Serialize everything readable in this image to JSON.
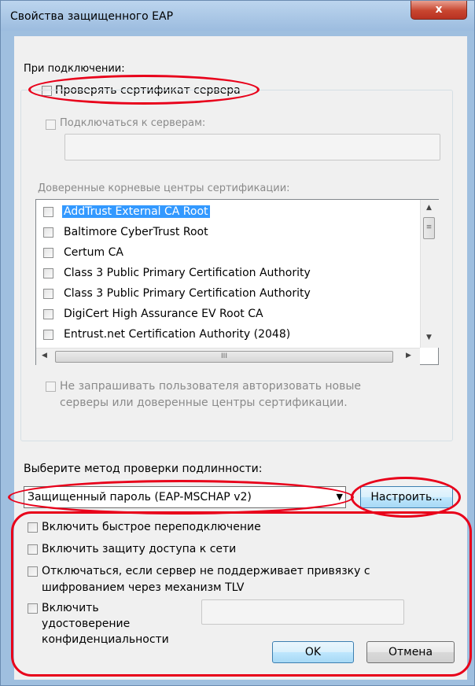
{
  "window": {
    "title": "Свойства защищенного EAP",
    "close_glyph": "x"
  },
  "connection": {
    "heading": "При подключении:",
    "verify_cert_label": "Проверять сертификат сервера",
    "connect_servers_label": "Подключаться к серверам:",
    "servers_value": "",
    "trusted_ca_label": "Доверенные корневые центры сертификации:",
    "ca_list": [
      {
        "label": "AddTrust External CA Root",
        "checked": false,
        "selected": true
      },
      {
        "label": "Baltimore CyberTrust Root",
        "checked": false,
        "selected": false
      },
      {
        "label": "Certum CA",
        "checked": false,
        "selected": false
      },
      {
        "label": "Class 3 Public Primary Certification Authority",
        "checked": false,
        "selected": false
      },
      {
        "label": "Class 3 Public Primary Certification Authority",
        "checked": false,
        "selected": false
      },
      {
        "label": "DigiCert High Assurance EV Root CA",
        "checked": false,
        "selected": false
      },
      {
        "label": "Entrust.net Certification Authority (2048)",
        "checked": false,
        "selected": false
      }
    ],
    "scroll_thumb_v": "≡",
    "scroll_thumb_h": "III",
    "no_prompt_label_1": "Не запрашивать пользователя авторизовать новые",
    "no_prompt_label_2": "серверы или доверенные центры сертификации."
  },
  "auth": {
    "heading": "Выберите метод проверки подлинности:",
    "method_value": "Защищенный пароль (EAP-MSCHAP v2)",
    "configure_label": "Настроить...",
    "fast_reconnect_label": "Включить быстрое переподключение",
    "nap_label": "Включить защиту доступа к сети",
    "tlv_label_1": "Отключаться, если сервер не поддерживает привязку с",
    "tlv_label_2": "шифрованием через механизм TLV",
    "identity_label_1": "Включить",
    "identity_label_2": "удостоверение",
    "identity_label_3": "конфиденциальности",
    "identity_value": ""
  },
  "footer": {
    "ok_label": "OK",
    "cancel_label": "Отмена"
  },
  "colors": {
    "annotation": "#e8001a",
    "selection": "#3399ff"
  }
}
